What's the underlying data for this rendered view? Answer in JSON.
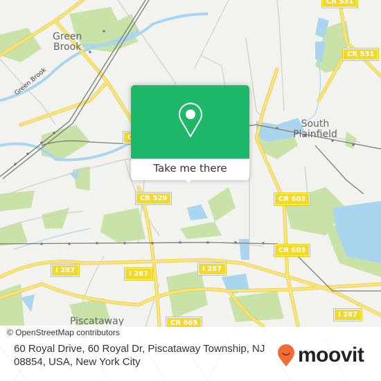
{
  "map": {
    "place_labels": [
      {
        "id": "green-brook",
        "text": "Green\nBrook"
      },
      {
        "id": "south-plainfield",
        "text": "South\nPlainfield"
      },
      {
        "id": "piscataway",
        "text": "Piscataway"
      }
    ],
    "water_labels": [
      {
        "id": "green-brook-stream",
        "text": "Green Brook"
      }
    ],
    "road_shields": [
      {
        "id": "cr-531-top",
        "text": "CR 531"
      },
      {
        "id": "cr-531",
        "text": "CR 531"
      },
      {
        "id": "cr-partial",
        "text": "C"
      },
      {
        "id": "cr-529",
        "text": "CR 529"
      },
      {
        "id": "cr-603-a",
        "text": "CR 603"
      },
      {
        "id": "cr-603-b",
        "text": "CR 603"
      },
      {
        "id": "i-287-a",
        "text": "I 287"
      },
      {
        "id": "i-287-b",
        "text": "I 287"
      },
      {
        "id": "i-287-c",
        "text": "I 287"
      },
      {
        "id": "i-287-d",
        "text": "I 287"
      },
      {
        "id": "cr-665",
        "text": "CR 665"
      }
    ],
    "colors": {
      "land": "#f2f2ee",
      "park": "#c8e2a8",
      "water": "#a9d6ee",
      "road": "#f4e06a",
      "shield": "#f2d92b",
      "rail": "#777777"
    }
  },
  "popup": {
    "icon": "map-pin-icon",
    "button_label": "Take me there",
    "accent": "#1fb86a"
  },
  "attribution": "© OpenStreetMap contributors",
  "footer": {
    "address": "60 Royal Drive, 60 Royal Dr, Piscataway Township, NJ 08854, USA, New York City",
    "brand": "moovit",
    "brand_color": "#f26a35"
  }
}
